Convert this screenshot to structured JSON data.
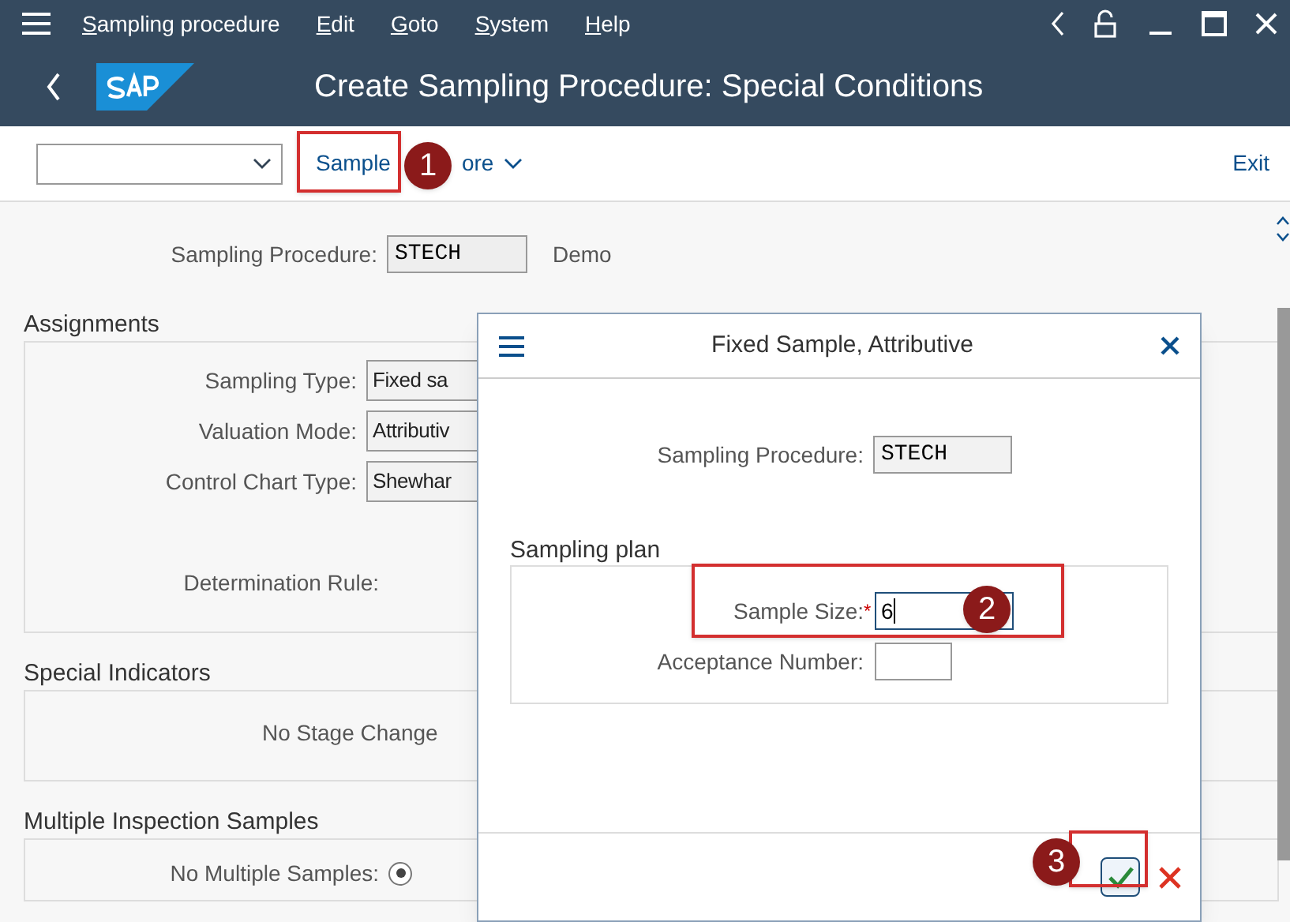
{
  "menu_bar": {
    "items": [
      "Sampling procedure",
      "Edit",
      "Goto",
      "System",
      "Help"
    ]
  },
  "title": "Create Sampling Procedure: Special Conditions",
  "toolbar": {
    "buttons": [
      "Sample",
      "ore"
    ],
    "exit": "Exit"
  },
  "header_field": {
    "label": "Sampling Procedure:",
    "value": "STECH",
    "description": "Demo"
  },
  "sections": [
    {
      "title": "Assignments",
      "rows": [
        {
          "kind": "field",
          "label": "Sampling Type:",
          "value": "Fixed sa"
        },
        {
          "kind": "field",
          "label": "Valuation Mode:",
          "value": "Attributiv"
        },
        {
          "kind": "field",
          "label": "Control Chart Type:",
          "value": "Shewhar"
        },
        {
          "kind": "label",
          "label": "Determination Rule:"
        }
      ]
    },
    {
      "title": "Special Indicators",
      "rows": [
        {
          "kind": "text",
          "label": "No Stage Change"
        }
      ]
    },
    {
      "title": "Multiple Inspection Samples",
      "rows": [
        {
          "kind": "radio",
          "label": "No Multiple Samples:",
          "selected": true
        }
      ]
    }
  ],
  "dialog": {
    "title": "Fixed Sample, Attributive",
    "procedure_label": "Sampling Procedure:",
    "procedure_value": "STECH",
    "group": "Sampling plan",
    "fields": [
      {
        "label": "Sample Size:",
        "marker": "*",
        "value": "6"
      },
      {
        "label": "Acceptance Number:"
      }
    ]
  },
  "annotations": [
    "1",
    "2",
    "3"
  ]
}
